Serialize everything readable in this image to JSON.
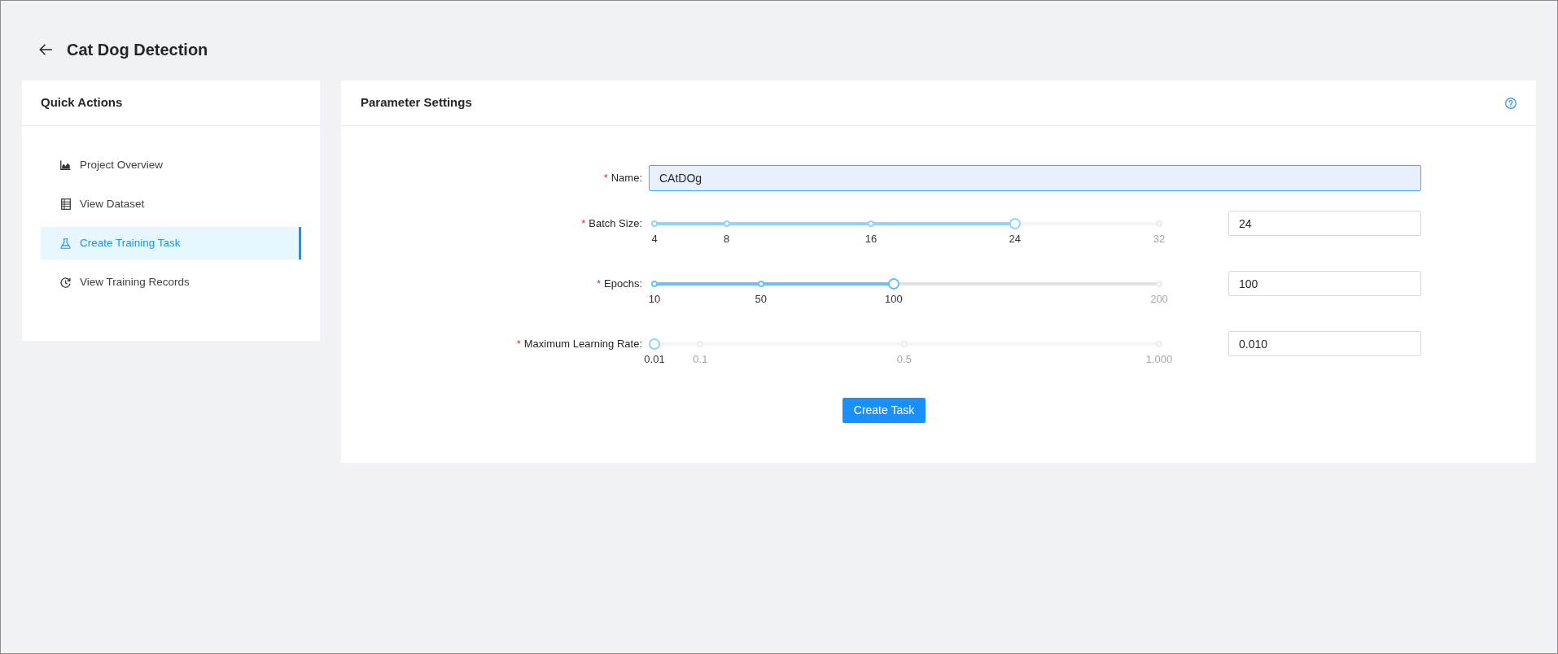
{
  "header": {
    "title": "Cat Dog Detection"
  },
  "sidebar": {
    "title": "Quick Actions",
    "items": [
      {
        "label": "Project Overview",
        "selected": false
      },
      {
        "label": "View Dataset",
        "selected": false
      },
      {
        "label": "Create Training Task",
        "selected": true
      },
      {
        "label": "View Training Records",
        "selected": false
      }
    ]
  },
  "panel": {
    "title": "Parameter Settings",
    "fields": [
      {
        "kind": "text",
        "required_mark": "*",
        "label": "Name:",
        "value": "CAtDOg",
        "focused": true
      },
      {
        "kind": "slider",
        "required_mark": "*",
        "label": "Batch Size:",
        "level": 0.714,
        "hovered": false,
        "marks": [
          {
            "label": "4",
            "level": 0
          },
          {
            "label": "8",
            "level": 0.143
          },
          {
            "label": "16",
            "level": 0.429
          },
          {
            "label": "24",
            "level": 0.714
          },
          {
            "label": "32",
            "level": 1
          }
        ],
        "value": "24"
      },
      {
        "kind": "slider",
        "required_mark": "*",
        "label": "Epochs:",
        "level": 0.474,
        "hovered": true,
        "marks": [
          {
            "label": "10",
            "level": 0
          },
          {
            "label": "50",
            "level": 0.211
          },
          {
            "label": "100",
            "level": 0.474
          },
          {
            "label": "200",
            "level": 1
          }
        ],
        "value": "100"
      },
      {
        "kind": "slider",
        "required_mark": "*",
        "label": "Maximum Learning Rate:",
        "level": 0,
        "hovered": false,
        "marks": [
          {
            "label": "0.01",
            "level": 0
          },
          {
            "label": "0.1",
            "level": 0.091
          },
          {
            "label": "0.5",
            "level": 0.495
          },
          {
            "label": "1.000",
            "level": 1
          }
        ],
        "value": "0.010"
      }
    ],
    "submit": {
      "label": "Create Task"
    }
  }
}
